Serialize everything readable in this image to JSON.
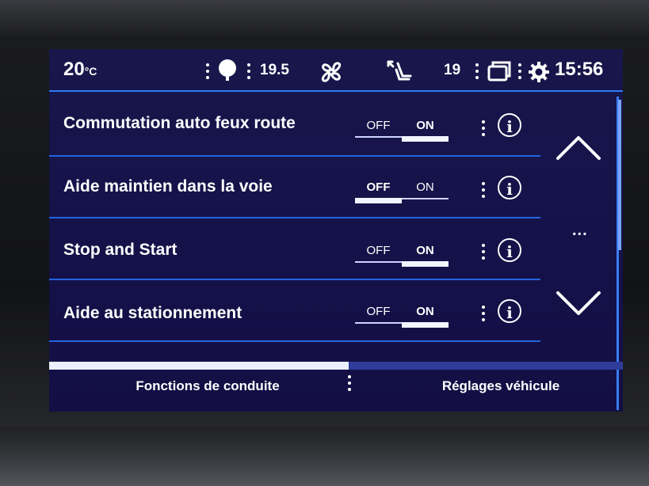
{
  "status_bar": {
    "temp_left_value": "20",
    "temp_left_unit": "°C",
    "fan_temp_value": "19.5",
    "temp_right_value": "19",
    "time": "15:56",
    "icons": [
      "climate-dot-icon",
      "fan-icon",
      "seat-airflow-icon",
      "recirculation-icon",
      "gear-icon"
    ]
  },
  "settings": [
    {
      "label": "Commutation auto feux route",
      "off_label": "OFF",
      "on_label": "ON",
      "state": "ON"
    },
    {
      "label": "Aide maintien dans la voie",
      "off_label": "OFF",
      "on_label": "ON",
      "state": "OFF"
    },
    {
      "label": "Stop and Start",
      "off_label": "OFF",
      "on_label": "ON",
      "state": "ON"
    },
    {
      "label": "Aide au stationnement",
      "off_label": "OFF",
      "on_label": "ON",
      "state": "ON"
    }
  ],
  "info_glyph": "i",
  "scroll": {
    "more_indicator": "..."
  },
  "tabs": [
    {
      "label": "Fonctions de conduite",
      "active": true
    },
    {
      "label": "Réglages véhicule",
      "active": false
    }
  ],
  "colors": {
    "screen_bg": "#15124a",
    "accent_blue": "#2e7cf6",
    "text": "#ffffff"
  }
}
